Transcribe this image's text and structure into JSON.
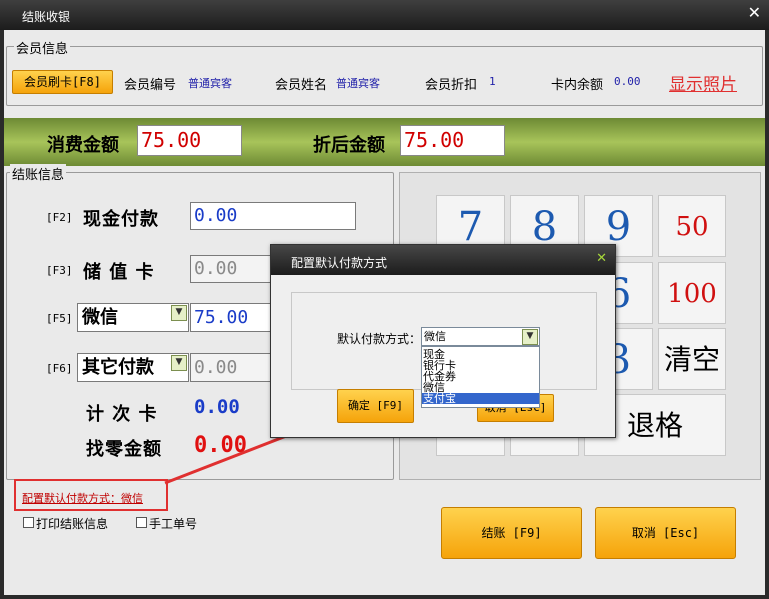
{
  "window": {
    "title": "结账收银",
    "close": "✕"
  },
  "member": {
    "legend": "会员信息",
    "swipe_button": "会员刷卡[F8]",
    "no_label": "会员编号",
    "no_value": "普通宾客",
    "name_label": "会员姓名",
    "name_value": "普通宾客",
    "discount_label": "会员折扣",
    "discount_value": "1",
    "balance_label": "卡内余额",
    "balance_value": "0.00",
    "show_photo": "显示照片"
  },
  "amounts": {
    "consume_label": "消费金额",
    "consume_value": "75.00",
    "after_label": "折后金额",
    "after_value": "75.00"
  },
  "checkout": {
    "legend": "结账信息",
    "cash": {
      "key": "[F2]",
      "label": "现金付款",
      "value": "0.00"
    },
    "card": {
      "key": "[F3]",
      "label": "储 值 卡",
      "value": "0.00"
    },
    "wechat": {
      "key": "[F5]",
      "label": "微信",
      "value": "75.00"
    },
    "other": {
      "key": "[F6]",
      "label": "其它付款",
      "value": "0.00"
    },
    "count_card": {
      "label": "计 次 卡",
      "value": "0.00"
    },
    "change": {
      "label": "找零金额",
      "value": "0.00"
    }
  },
  "keypad": {
    "k7": "7",
    "k8": "8",
    "k9": "9",
    "k50": "50",
    "k6": "6",
    "k100": "100",
    "k3": "3",
    "clear": "清空",
    "back": "退格"
  },
  "footer": {
    "config_link": "配置默认付款方式：微信",
    "print_label": "打印结账信息",
    "manual_label": "手工单号",
    "checkout_btn": "结账 [F9]",
    "cancel_btn": "取消 [Esc]"
  },
  "dialog": {
    "title": "配置默认付款方式",
    "close": "✕",
    "field_label": "默认付款方式：",
    "selected": "微信",
    "options": [
      "现金",
      "银行卡",
      "代金券",
      "微信",
      "支付宝"
    ],
    "highlighted_option": "支付宝",
    "ok_button": "确定 [F9]",
    "cancel_button": "取消 [Esc]"
  },
  "colors": {
    "accent_orange": "#f5a30a",
    "amount_red": "#d00000",
    "value_blue": "#1a3cc8",
    "highlight_red": "#e03030",
    "band_green": "#8aa848"
  }
}
